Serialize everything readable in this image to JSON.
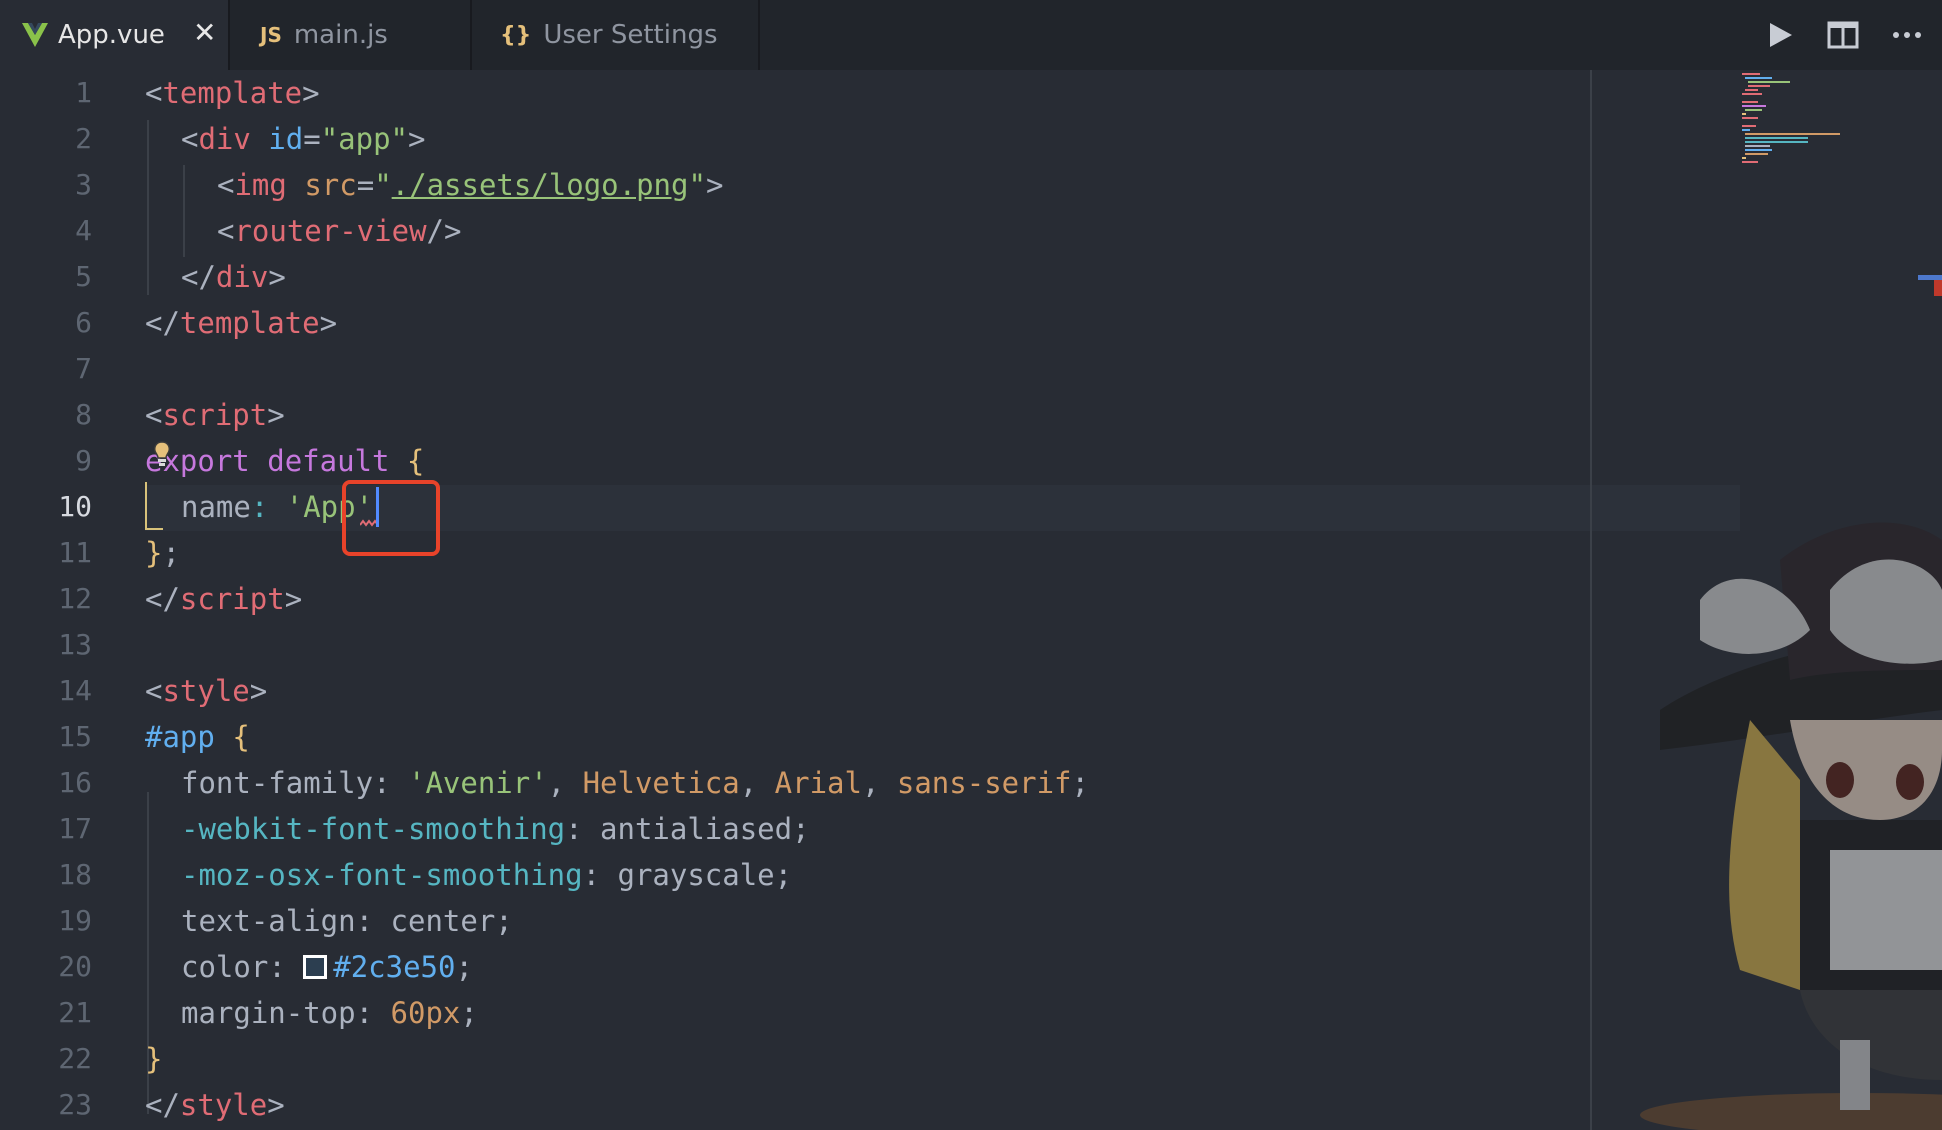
{
  "tabs": [
    {
      "label": "App.vue",
      "icon": "V",
      "active": true
    },
    {
      "label": "main.js",
      "icon": "JS",
      "active": false
    },
    {
      "label": "User Settings",
      "icon": "{}",
      "active": false
    }
  ],
  "close_symbol": "✕",
  "line_numbers": [
    "1",
    "2",
    "3",
    "4",
    "5",
    "6",
    "7",
    "8",
    "9",
    "10",
    "11",
    "12",
    "13",
    "14",
    "15",
    "16",
    "17",
    "18",
    "19",
    "20",
    "21",
    "22",
    "23"
  ],
  "current_line": "10",
  "code": {
    "l1": [
      "<",
      "template",
      ">"
    ],
    "l2": [
      "<",
      "div",
      " ",
      "id",
      "=",
      "\"app\"",
      ">"
    ],
    "l3": [
      "<",
      "img",
      " ",
      "src",
      "=",
      "\"",
      "./assets/logo.png",
      "\"",
      ">"
    ],
    "l4": [
      "<",
      "router-view",
      "/>"
    ],
    "l5": [
      "</",
      "div",
      ">"
    ],
    "l6": [
      "</",
      "template",
      ">"
    ],
    "l8": [
      "<",
      "script",
      ">"
    ],
    "l9": [
      "export",
      " ",
      "default",
      " ",
      "{"
    ],
    "l10": [
      "name",
      ": ",
      "'App'"
    ],
    "l11": [
      "}",
      ";"
    ],
    "l12": [
      "</",
      "script",
      ">"
    ],
    "l14": [
      "<",
      "style",
      ">"
    ],
    "l15": [
      "#app",
      " ",
      "{"
    ],
    "l16": [
      "font-family",
      ": ",
      "'Avenir'",
      ", ",
      "Helvetica",
      ", ",
      "Arial",
      ", ",
      "sans-serif",
      ";"
    ],
    "l17": [
      "-webkit-font-smoothing",
      ": ",
      "antialiased",
      ";"
    ],
    "l18": [
      "-moz-osx-font-smoothing",
      ": ",
      "grayscale",
      ";"
    ],
    "l19": [
      "text-align",
      ": ",
      "center",
      ";"
    ],
    "l20": [
      "color",
      ": ",
      "#2c3e50",
      ";"
    ],
    "l21": [
      "margin-top",
      ": ",
      "60px",
      ";"
    ],
    "l22": [
      "}"
    ],
    "l23": [
      "</",
      "style",
      ">"
    ]
  },
  "icons": {
    "vue_tab": "vue-logo-icon",
    "js_tab": "js-file-icon",
    "settings_tab": "json-braces-icon",
    "run": "play-icon",
    "split": "split-editor-icon",
    "more": "more-actions-icon",
    "lightbulb": "lightbulb-icon"
  },
  "colors": {
    "background": "#282c34",
    "tabbar": "#21252b",
    "highlight_box": "#e8432a",
    "caret": "#528bff"
  }
}
